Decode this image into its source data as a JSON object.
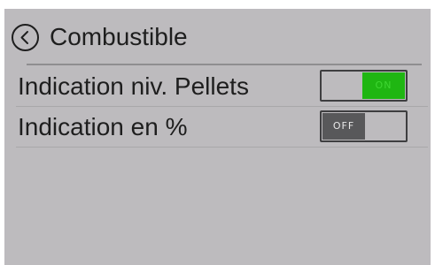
{
  "header": {
    "title": "Combustible",
    "back_icon": "chevron-left-circle-icon"
  },
  "settings": [
    {
      "label": "Indication niv. Pellets",
      "toggle_text": "ON",
      "state": "on"
    },
    {
      "label": "Indication en %",
      "toggle_text": "OFF",
      "state": "off"
    }
  ],
  "colors": {
    "background": "#bdbbbe",
    "toggle_on": "#1fb612",
    "toggle_off": "#58585a"
  }
}
